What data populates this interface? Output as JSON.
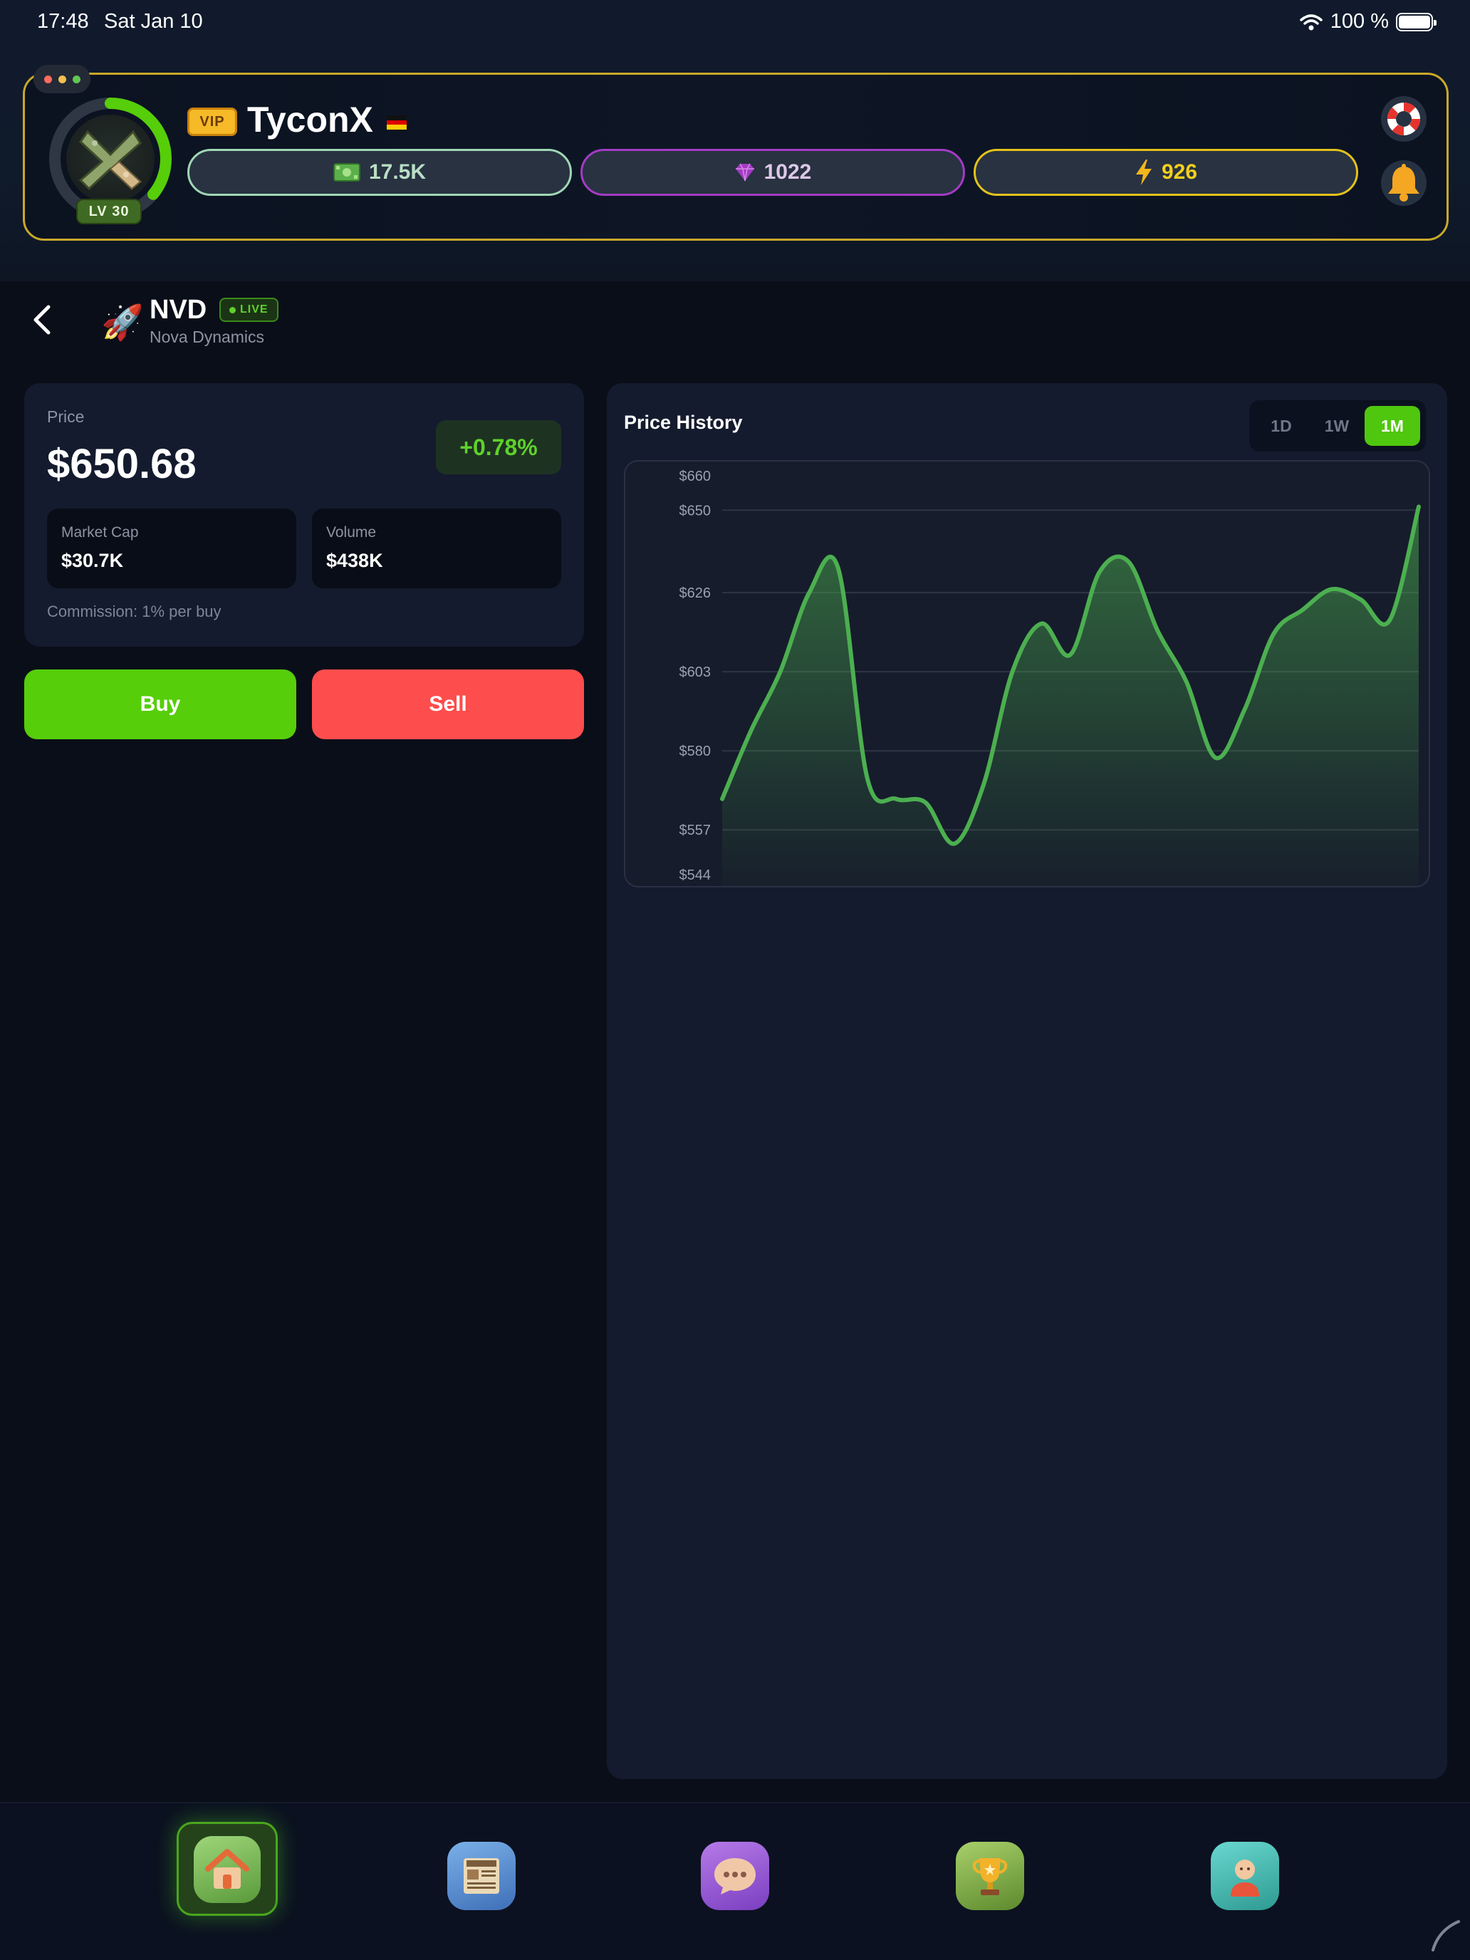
{
  "status_bar": {
    "time": "17:48",
    "date": "Sat Jan 10",
    "battery": "100 %"
  },
  "profile": {
    "vip_label": "VIP",
    "username": "TyconX",
    "level": "LV 30",
    "level_progress": 0.36,
    "cash": "17.5K",
    "gems": "1022",
    "energy": "926",
    "flag_colors": [
      "#111111",
      "#dd0000",
      "#ffce00"
    ]
  },
  "stock": {
    "ticker": "NVD",
    "name": "Nova Dynamics",
    "live_label": "LIVE",
    "emoji": "🚀",
    "price_label": "Price",
    "price": "$650.68",
    "change": "+0.78%",
    "market_cap_label": "Market Cap",
    "market_cap": "$30.7K",
    "volume_label": "Volume",
    "volume": "$438K",
    "commission": "Commission: 1% per buy"
  },
  "actions": {
    "buy": "Buy",
    "sell": "Sell"
  },
  "history": {
    "title": "Price History",
    "ranges": [
      "1D",
      "1W",
      "1M"
    ],
    "active_range": "1M"
  },
  "chart_data": {
    "type": "area",
    "title": "",
    "xlabel": "",
    "ylabel": "",
    "y_ticks": [
      "$660",
      "$650",
      "$626",
      "$603",
      "$580",
      "$557",
      "$544"
    ],
    "y_tick_values": [
      660,
      650,
      626,
      603,
      580,
      557,
      544
    ],
    "ylim": [
      544,
      660
    ],
    "grid": true,
    "line_color": "#4caf50",
    "series": [
      {
        "values": [
          566,
          586,
          603,
          626,
          633,
          572,
          566,
          565,
          553,
          570,
          603,
          617,
          608,
          632,
          635,
          615,
          600,
          578,
          592,
          614,
          621,
          627,
          624,
          618,
          651
        ]
      }
    ]
  },
  "nav": {
    "items": [
      "home",
      "news",
      "chat",
      "trophy",
      "profile"
    ],
    "active": "home"
  },
  "colors": {
    "accent_green": "#56ce0a",
    "sell_red": "#fd4d4d",
    "gold": "#c9a82a"
  }
}
